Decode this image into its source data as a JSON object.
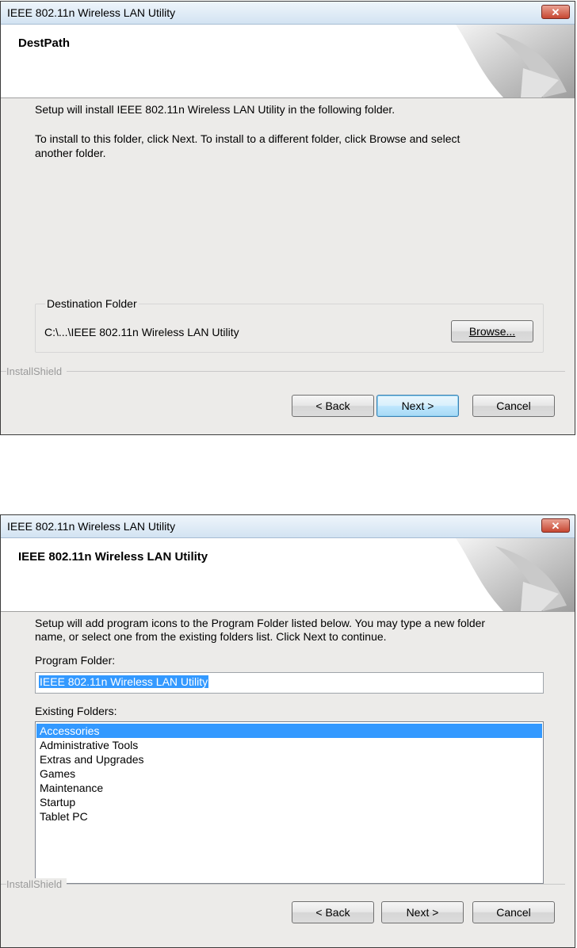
{
  "dialog1": {
    "title": "IEEE 802.11n Wireless LAN Utility",
    "close_label": "✕",
    "header_title": "DestPath",
    "intro_text": "Setup will install IEEE 802.11n Wireless LAN Utility in the following folder.",
    "instructions_line1": "To install to this folder, click Next. To install to a different folder, click Browse and select",
    "instructions_line2": "another folder.",
    "destination_group_label": "Destination Folder",
    "destination_path": "C:\\...\\IEEE 802.11n Wireless LAN Utility",
    "browse_label": "Browse...",
    "installshield_label": "InstallShield",
    "back_label": "< Back",
    "next_label": "Next >",
    "cancel_label": "Cancel"
  },
  "dialog2": {
    "title": "IEEE 802.11n Wireless LAN Utility",
    "close_label": "✕",
    "header_title": "IEEE 802.11n Wireless LAN Utility",
    "intro_line1": "Setup will add program icons to the Program Folder listed below.  You may type a new folder",
    "intro_line2": "name, or select one from the existing folders list.  Click Next to continue.",
    "program_folder_label": "Program Folder:",
    "program_folder_value": "IEEE 802.11n Wireless LAN Utility",
    "existing_folders_label": "Existing Folders:",
    "existing_folders": [
      "Accessories",
      "Administrative Tools",
      "Extras and Upgrades",
      "Games",
      "Maintenance",
      "Startup",
      "Tablet PC"
    ],
    "selected_folder": "Accessories",
    "installshield_label": "InstallShield",
    "back_label": "< Back",
    "next_label": "Next >",
    "cancel_label": "Cancel"
  },
  "colors": {
    "dialog_bg": "#ecebe9",
    "selection": "#3399ff",
    "close_button": "#c74732",
    "default_button": "#bee6fd"
  }
}
